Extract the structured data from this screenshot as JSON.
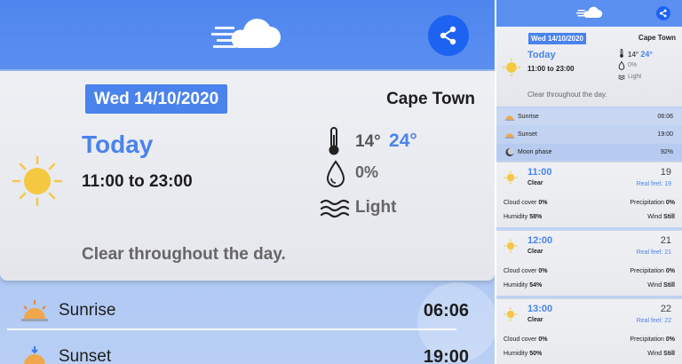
{
  "colors": {
    "accent": "#4a83ec",
    "topbar": "#5a8ff0",
    "share": "#1c63f2"
  },
  "icons": {
    "logo": "cloud-logo-icon",
    "share": "share-icon",
    "sun": "sun-icon",
    "thermometer": "thermometer-icon",
    "drop": "water-drop-icon",
    "wind": "wind-icon",
    "sunrise": "sunrise-icon",
    "sunset": "sunset-icon",
    "moon": "moon-phase-icon"
  },
  "today": {
    "date": "Wed 14/10/2020",
    "city": "Cape Town",
    "label": "Today",
    "hours": "11:00 to 23:00",
    "temp_low": "14°",
    "temp_high": "24°",
    "precipitation": "0%",
    "wind": "Light",
    "description": "Clear throughout the day."
  },
  "sun_rows": [
    {
      "label": "Sunrise",
      "value": "06:06"
    },
    {
      "label": "Sunset",
      "value": "19:00"
    },
    {
      "label": "Moon phase",
      "value": "92%"
    }
  ],
  "hourly": [
    {
      "time": "11:00",
      "condition": "Clear",
      "temp": "19",
      "real_feel": "Real feel: 19",
      "cloud_cover_label": "Cloud cover",
      "cloud_cover": "0%",
      "precip_label": "Precipitation",
      "precip": "0%",
      "humidity_label": "Humidity",
      "humidity": "58%",
      "wind_label": "Wind",
      "wind": "Still"
    },
    {
      "time": "12:00",
      "condition": "Clear",
      "temp": "21",
      "real_feel": "Real feel: 21",
      "cloud_cover_label": "Cloud cover",
      "cloud_cover": "0%",
      "precip_label": "Precipitation",
      "precip": "0%",
      "humidity_label": "Humidity",
      "humidity": "54%",
      "wind_label": "Wind",
      "wind": "Still"
    },
    {
      "time": "13:00",
      "condition": "Clear",
      "temp": "22",
      "real_feel": "Real feel: 22",
      "cloud_cover_label": "Cloud cover",
      "cloud_cover": "0%",
      "precip_label": "Precipitation",
      "precip": "0%",
      "humidity_label": "Humidity",
      "humidity": "50%",
      "wind_label": "Wind",
      "wind": "Still"
    }
  ]
}
